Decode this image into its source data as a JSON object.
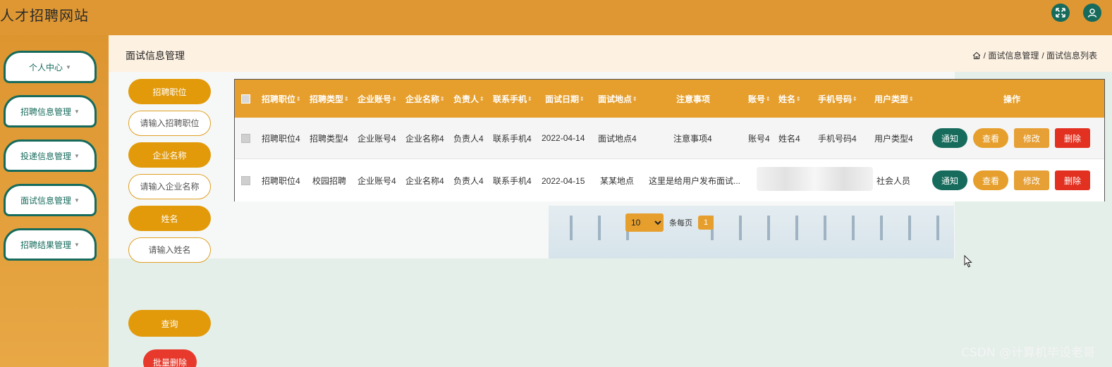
{
  "site": {
    "title": "人才招聘网站"
  },
  "header_icons": [
    {
      "icon": "fullscreen-icon",
      "color": "#166b5c"
    },
    {
      "icon": "user-icon",
      "color": "#166b5c"
    }
  ],
  "sidebar": {
    "items": [
      {
        "label": "个人中心"
      },
      {
        "label": "招聘信息管理"
      },
      {
        "label": "投递信息管理"
      },
      {
        "label": "面试信息管理"
      },
      {
        "label": "招聘结果管理"
      }
    ]
  },
  "page": {
    "title": "面试信息管理",
    "breadcrumb": [
      "/ 面试信息管理",
      "/ 面试信息列表"
    ]
  },
  "search": {
    "position_label": "招聘职位",
    "position_placeholder": "请输入招聘职位",
    "company_label": "企业名称",
    "company_placeholder": "请输入企业名称",
    "name_label": "姓名",
    "name_placeholder": "请输入姓名",
    "query_button": "查询",
    "batch_delete_button": "批量删除"
  },
  "table": {
    "headers": {
      "position": "招聘职位",
      "type": "招聘类型",
      "account": "企业账号",
      "company": "企业名称",
      "owner": "负责人",
      "phone": "联系手机",
      "date": "面试日期",
      "place": "面试地点",
      "notes": "注意事项",
      "acct": "账号",
      "name": "姓名",
      "mobile": "手机号码",
      "usertype": "用户类型",
      "ops": "操作"
    },
    "rows": [
      {
        "position": "招聘职位4",
        "type": "招聘类型4",
        "account": "企业账号4",
        "company": "企业名称4",
        "owner": "负责人4",
        "phone": "联系手机4",
        "date": "2022-04-14",
        "place": "面试地点4",
        "notes": "注意事项4",
        "acct": "账号4",
        "name": "姓名4",
        "mobile": "手机号码4",
        "usertype": "用户类型4"
      },
      {
        "position": "招聘职位4",
        "type": "校园招聘",
        "account": "企业账号4",
        "company": "企业名称4",
        "owner": "负责人4",
        "phone": "联系手机4",
        "date": "2022-04-15",
        "place": "某某地点",
        "notes": "这里是给用户发布面试...",
        "usertype": "社会人员"
      }
    ],
    "actions": {
      "notify": "通知",
      "view": "查看",
      "edit": "修改",
      "delete": "删除"
    }
  },
  "pagination": {
    "page_size": "10",
    "per_page_label": "条每页",
    "current_page": "1"
  },
  "watermark": "CSDN @计算机毕设老哥",
  "colors": {
    "header": "#de9732",
    "accent": "#e69f2d",
    "green": "#166b5c",
    "danger": "#e23121"
  }
}
